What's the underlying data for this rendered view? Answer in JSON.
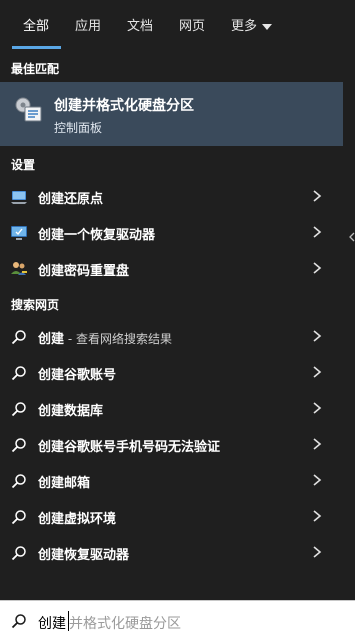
{
  "tabs": [
    {
      "label": "全部",
      "active": true
    },
    {
      "label": "应用",
      "active": false
    },
    {
      "label": "文档",
      "active": false
    },
    {
      "label": "网页",
      "active": false
    },
    {
      "label": "更多",
      "active": false
    }
  ],
  "sections": {
    "best_match": "最佳匹配",
    "settings": "设置",
    "web": "搜索网页"
  },
  "best_match": {
    "title": "创建并格式化硬盘分区",
    "subtitle": "控制面板",
    "icon": "control-panel-disk-icon"
  },
  "settings_items": [
    {
      "label": "创建还原点",
      "icon": "restore-point-icon"
    },
    {
      "label": "创建一个恢复驱动器",
      "icon": "recovery-drive-icon"
    },
    {
      "label": "创建密码重置盘",
      "icon": "users-key-icon"
    }
  ],
  "web_items": [
    {
      "label": "创建",
      "hint": " - 查看网络搜索结果"
    },
    {
      "label": "创建谷歌账号",
      "hint": ""
    },
    {
      "label": "创建数据库",
      "hint": ""
    },
    {
      "label": "创建谷歌账号手机号码无法验证",
      "hint": ""
    },
    {
      "label": "创建邮箱",
      "hint": ""
    },
    {
      "label": "创建虚拟环境",
      "hint": ""
    },
    {
      "label": "创建恢复驱动器",
      "hint": ""
    }
  ],
  "search": {
    "typed": "创建",
    "completion": "并格式化硬盘分区"
  },
  "colors": {
    "background": "#1f1f1f",
    "highlight": "#3a4a5b",
    "accent": "#5aa7e6"
  }
}
